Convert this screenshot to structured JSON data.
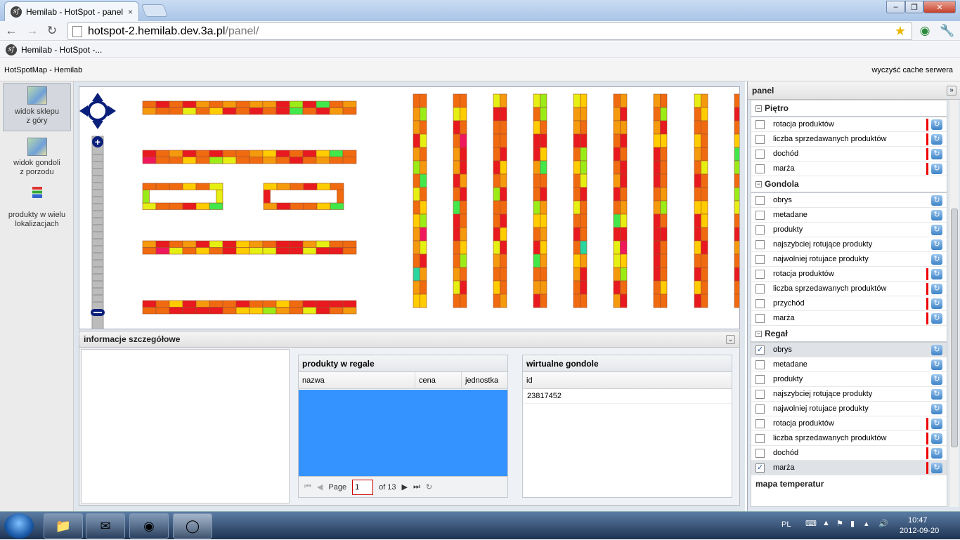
{
  "browser": {
    "tab_title": "Hemilab - HotSpot - panel",
    "tab_close": "×",
    "url_host": "hotspot-2.hemilab.dev.3a.pl",
    "url_path": "/panel/",
    "bookmark": "Hemilab - HotSpot -...",
    "win_minimize": "–",
    "win_restore": "❐",
    "win_close": "✕"
  },
  "app": {
    "title": "HotSpotMap - Hemilab",
    "clear_cache": "wyczyść cache serwera"
  },
  "leftnav": [
    {
      "label1": "widok sklepu",
      "label2": "z góry"
    },
    {
      "label1": "widok gondoli",
      "label2": "z porzodu"
    },
    {
      "label1": "produkty w wielu",
      "label2": "lokalizacjach"
    }
  ],
  "detail": {
    "title": "informacje szczegółowe",
    "products": {
      "title": "produkty w regale",
      "col_name": "nazwa",
      "col_price": "cena",
      "col_unit": "jednostka",
      "pager_page": "Page",
      "pager_value": "1",
      "pager_of": "of 13"
    },
    "virtual": {
      "title": "wirtualne gondole",
      "col_id": "id",
      "row_id": "23817452"
    }
  },
  "panel": {
    "title": "panel",
    "sections": [
      {
        "name": "Piętro",
        "items": [
          {
            "label": "rotacja produktów",
            "checked": false,
            "red": true
          },
          {
            "label": "liczba sprzedawanych produktów",
            "checked": false,
            "red": true
          },
          {
            "label": "dochód",
            "checked": false,
            "red": true
          },
          {
            "label": "marża",
            "checked": false,
            "red": true
          }
        ]
      },
      {
        "name": "Gondola",
        "items": [
          {
            "label": "obrys",
            "checked": false,
            "red": false
          },
          {
            "label": "metadane",
            "checked": false,
            "red": false
          },
          {
            "label": "produkty",
            "checked": false,
            "red": false
          },
          {
            "label": "najszybciej rotujące produkty",
            "checked": false,
            "red": false
          },
          {
            "label": "najwolniej rotujace produkty",
            "checked": false,
            "red": false
          },
          {
            "label": "rotacja produktów",
            "checked": false,
            "red": true
          },
          {
            "label": "liczba sprzedawanych produktów",
            "checked": false,
            "red": true
          },
          {
            "label": "przychód",
            "checked": false,
            "red": true
          },
          {
            "label": "marża",
            "checked": false,
            "red": true
          }
        ]
      },
      {
        "name": "Regał",
        "items": [
          {
            "label": "obrys",
            "checked": true,
            "red": false
          },
          {
            "label": "metadane",
            "checked": false,
            "red": false
          },
          {
            "label": "produkty",
            "checked": false,
            "red": false
          },
          {
            "label": "najszybciej rotujące produkty",
            "checked": false,
            "red": false
          },
          {
            "label": "najwolniej rotujace produkty",
            "checked": false,
            "red": false
          },
          {
            "label": "rotacja produktów",
            "checked": false,
            "red": true
          },
          {
            "label": "liczba sprzedawanych produktów",
            "checked": false,
            "red": true
          },
          {
            "label": "dochód",
            "checked": false,
            "red": true
          },
          {
            "label": "marża",
            "checked": true,
            "red": true
          }
        ]
      }
    ],
    "footer_section": "mapa temperatur"
  },
  "taskbar": {
    "lang": "PL",
    "time": "10:47",
    "date": "2012-09-20"
  },
  "heat_colors": [
    "#e8191f",
    "#f06a10",
    "#f49a0c",
    "#ffcc00",
    "#e6ef12",
    "#9bec16",
    "#42e84a",
    "#2ad6a0",
    "#2da7f0",
    "#f0185c"
  ]
}
